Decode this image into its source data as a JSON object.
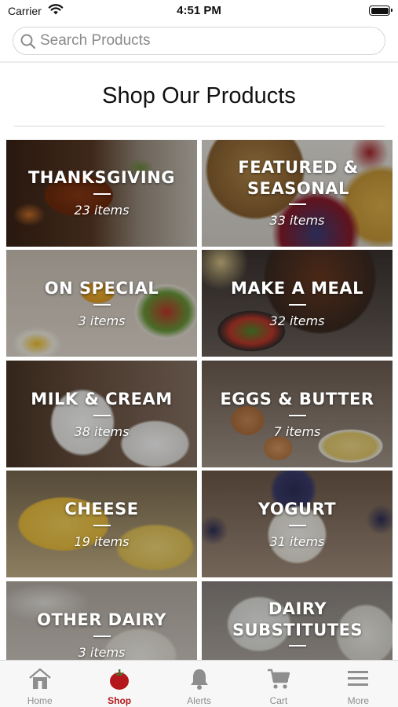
{
  "status_bar": {
    "carrier": "Carrier",
    "time": "4:51 PM"
  },
  "search": {
    "placeholder": "Search Products",
    "value": ""
  },
  "page_title": "Shop Our Products",
  "categories": [
    {
      "name": "THANKSGIVING",
      "count": "23  items"
    },
    {
      "name": "FEATURED & SEASONAL",
      "count": "33  items"
    },
    {
      "name": "ON SPECIAL",
      "count": "3  items"
    },
    {
      "name": "MAKE A MEAL",
      "count": "32  items"
    },
    {
      "name": "MILK & CREAM",
      "count": "38  items"
    },
    {
      "name": "EGGS & BUTTER",
      "count": "7  items"
    },
    {
      "name": "CHEESE",
      "count": "19  items"
    },
    {
      "name": "YOGURT",
      "count": "31  items"
    },
    {
      "name": "OTHER DAIRY",
      "count": "3  items"
    },
    {
      "name": "DAIRY SUBSTITUTES",
      "count": ""
    }
  ],
  "tabs": [
    {
      "label": "Home",
      "icon": "home-icon",
      "active": false
    },
    {
      "label": "Shop",
      "icon": "tomato-icon",
      "active": true
    },
    {
      "label": "Alerts",
      "icon": "bell-icon",
      "active": false
    },
    {
      "label": "Cart",
      "icon": "cart-icon",
      "active": false
    },
    {
      "label": "More",
      "icon": "menu-icon",
      "active": false
    }
  ],
  "colors": {
    "accent": "#b3171c",
    "inactive_tab": "#8e8e8e"
  }
}
